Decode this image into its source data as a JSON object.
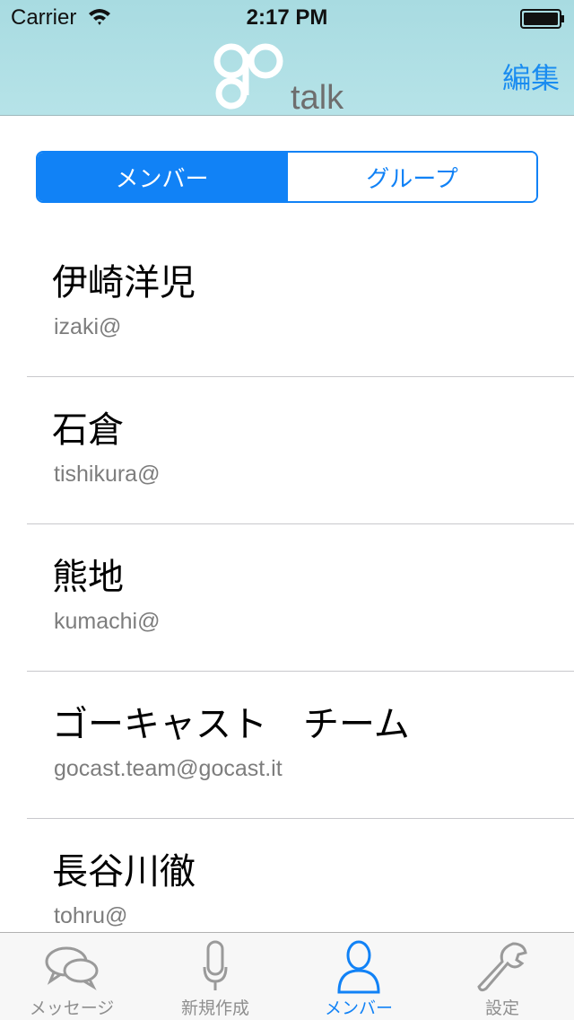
{
  "status_bar": {
    "carrier": "Carrier",
    "time": "2:17 PM"
  },
  "nav": {
    "logo_text": "talk",
    "logo_mark": "go",
    "edit_label": "編集"
  },
  "segments": [
    {
      "label": "メンバー",
      "selected": true
    },
    {
      "label": "グループ",
      "selected": false
    }
  ],
  "members": [
    {
      "name": "伊崎洋児",
      "email": "izaki@"
    },
    {
      "name": "石倉",
      "email": "tishikura@"
    },
    {
      "name": "熊地",
      "email": "kumachi@"
    },
    {
      "name": "ゴーキャスト　チーム",
      "email": "gocast.team@gocast.it"
    },
    {
      "name": "長谷川徹",
      "email": "tohru@"
    }
  ],
  "tabs": [
    {
      "label": "メッセージ",
      "icon": "chat-bubbles-icon",
      "active": false
    },
    {
      "label": "新規作成",
      "icon": "microphone-icon",
      "active": false
    },
    {
      "label": "メンバー",
      "icon": "person-icon",
      "active": true
    },
    {
      "label": "設定",
      "icon": "wrench-icon",
      "active": false
    }
  ],
  "colors": {
    "accent": "#1182f6",
    "header": "#b0e0e6",
    "logo": "#7a7a7a"
  }
}
